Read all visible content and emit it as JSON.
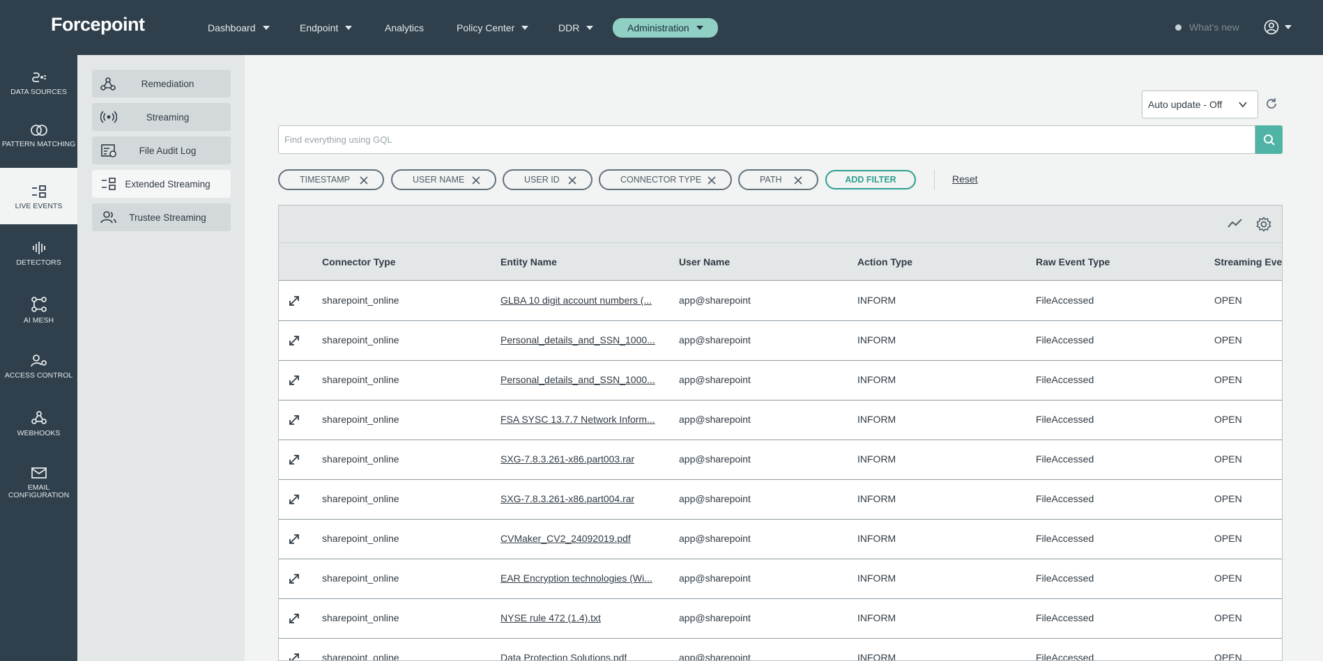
{
  "brand": {
    "logo_text": "Forcepoint"
  },
  "topnav": {
    "items": [
      {
        "label": "Dashboard",
        "dropdown": true
      },
      {
        "label": "Endpoint",
        "dropdown": true
      },
      {
        "label": "Analytics",
        "dropdown": false
      },
      {
        "label": "Policy Center",
        "dropdown": true
      },
      {
        "label": "DDR",
        "dropdown": true
      },
      {
        "label": "Administration",
        "dropdown": true,
        "active": true
      }
    ],
    "whats_new": "What's new",
    "user_icon": "user-circle-icon"
  },
  "rail": {
    "items": [
      {
        "label": "DATA SOURCES",
        "icon": "data-sources-icon"
      },
      {
        "label": "PATTERN MATCHING",
        "icon": "pattern-matching-icon"
      },
      {
        "label": "LIVE EVENTS",
        "icon": "live-events-icon",
        "active": true
      },
      {
        "label": "DETECTORS",
        "icon": "detectors-icon"
      },
      {
        "label": "AI MESH",
        "icon": "ai-mesh-icon"
      },
      {
        "label": "ACCESS CONTROL",
        "icon": "access-control-icon"
      },
      {
        "label": "WEBHOOKS",
        "icon": "webhooks-icon"
      },
      {
        "label": "EMAIL CONFIGURATION",
        "icon": "email-icon"
      }
    ]
  },
  "submenu": {
    "items": [
      {
        "label": "Remediation",
        "icon": "remediation-icon"
      },
      {
        "label": "Streaming",
        "icon": "streaming-icon"
      },
      {
        "label": "File Audit Log",
        "icon": "file-audit-log-icon"
      },
      {
        "label": "Extended Streaming",
        "icon": "extended-streaming-icon",
        "selected": true
      },
      {
        "label": "Trustee Streaming",
        "icon": "trustee-streaming-icon"
      }
    ]
  },
  "toolbar": {
    "auto_update": "Auto update - Off",
    "search_placeholder": "Find everything using GQL"
  },
  "filters": {
    "chips": [
      "TIMESTAMP",
      "USER NAME",
      "USER ID",
      "CONNECTOR TYPE",
      "PATH"
    ],
    "add_filter": "ADD FILTER",
    "reset": "Reset"
  },
  "table": {
    "columns": [
      "Connector Type",
      "Entity Name",
      "User Name",
      "Action Type",
      "Raw Event Type",
      "Streaming Ever"
    ],
    "rows": [
      [
        "sharepoint_online",
        "GLBA 10 digit account numbers (...",
        "app@sharepoint",
        "INFORM",
        "FileAccessed",
        "OPEN"
      ],
      [
        "sharepoint_online",
        "Personal_details_and_SSN_1000...",
        "app@sharepoint",
        "INFORM",
        "FileAccessed",
        "OPEN"
      ],
      [
        "sharepoint_online",
        "Personal_details_and_SSN_1000...",
        "app@sharepoint",
        "INFORM",
        "FileAccessed",
        "OPEN"
      ],
      [
        "sharepoint_online",
        "FSA SYSC 13.7.7 Network Inform...",
        "app@sharepoint",
        "INFORM",
        "FileAccessed",
        "OPEN"
      ],
      [
        "sharepoint_online",
        "SXG-7.8.3.261-x86.part003.rar",
        "app@sharepoint",
        "INFORM",
        "FileAccessed",
        "OPEN"
      ],
      [
        "sharepoint_online",
        "SXG-7.8.3.261-x86.part004.rar",
        "app@sharepoint",
        "INFORM",
        "FileAccessed",
        "OPEN"
      ],
      [
        "sharepoint_online",
        "CVMaker_CV2_24092019.pdf",
        "app@sharepoint",
        "INFORM",
        "FileAccessed",
        "OPEN"
      ],
      [
        "sharepoint_online",
        "EAR Encryption technologies (Wi...",
        "app@sharepoint",
        "INFORM",
        "FileAccessed",
        "OPEN"
      ],
      [
        "sharepoint_online",
        "NYSE rule 472 (1.4).txt",
        "app@sharepoint",
        "INFORM",
        "FileAccessed",
        "OPEN"
      ],
      [
        "sharepoint_online",
        "Data Protection Solutions.pdf",
        "app@sharepoint",
        "INFORM",
        "FileAccessed",
        "OPEN"
      ]
    ]
  },
  "colors": {
    "nav_bg": "#2f3f4b",
    "accent": "#4fb4a5",
    "active_pill": "#8fcfc4",
    "add_filter": "#2d9f8f"
  }
}
